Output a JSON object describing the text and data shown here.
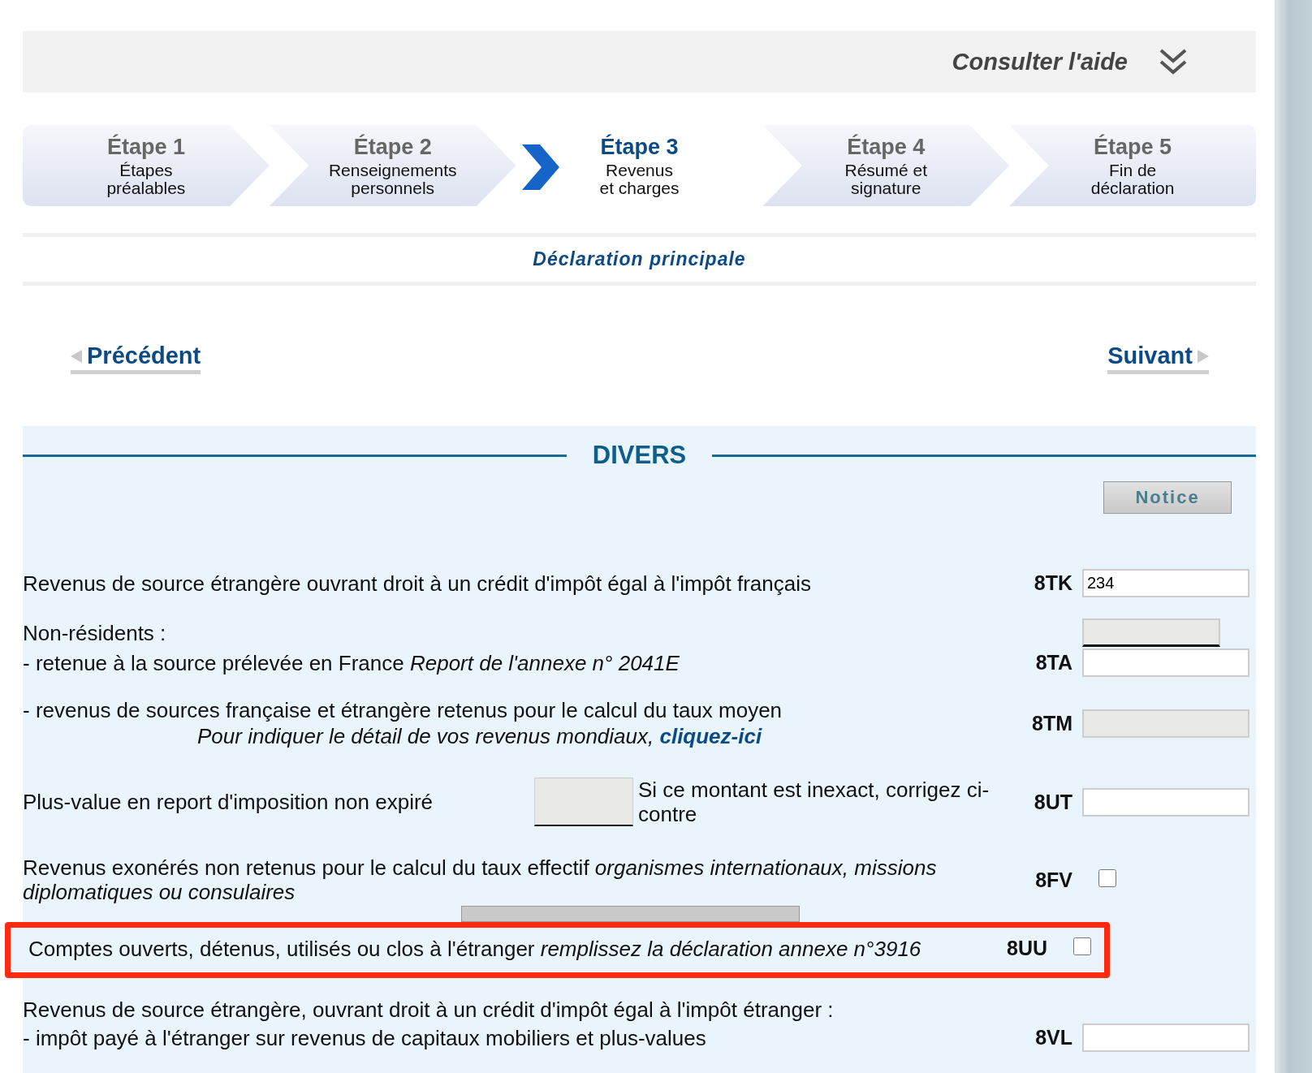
{
  "help": {
    "label": "Consulter l'aide"
  },
  "steps": [
    {
      "title": "Étape 1",
      "lines": [
        "Étapes",
        "préalables"
      ],
      "selected": false
    },
    {
      "title": "Étape 2",
      "lines": [
        "Renseignements",
        "personnels"
      ],
      "selected": false
    },
    {
      "title": "Étape 3",
      "lines": [
        "Revenus",
        "et charges"
      ],
      "selected": true
    },
    {
      "title": "Étape 4",
      "lines": [
        "Résumé et",
        "signature"
      ],
      "selected": false
    },
    {
      "title": "Étape 5",
      "lines": [
        "Fin de",
        "déclaration"
      ],
      "selected": false
    }
  ],
  "section_title": "Déclaration principale",
  "nav": {
    "previous": "Précédent",
    "next": "Suivant"
  },
  "divers": {
    "title": "DIVERS",
    "notice_button": "Notice",
    "rows": [
      {
        "kind": "input",
        "label": "Revenus de source étrangère ouvrant droit à un crédit d'impôt égal à l'impôt français",
        "code": "8TK",
        "value": "234",
        "disabled": false
      },
      {
        "kind": "heading-field",
        "label": "Non-résidents :"
      },
      {
        "kind": "input",
        "label": " - retenue à la source prélevée en France *Report de l'annexe n° 2041E*",
        "code": "8TA",
        "disabled": false
      },
      {
        "kind": "input",
        "label": " - revenus de sources française et étrangère retenus pour le calcul du taux moyen",
        "code": "8TM",
        "disabled": true,
        "sub": {
          "text": "Pour indiquer le détail de vos revenus mondiaux,",
          "link": "cliquez-ici"
        }
      },
      {
        "kind": "correction",
        "label": "Plus-value en report d'imposition non expiré",
        "side": "Si ce montant est inexact, corrigez ci-contre",
        "code": "8UT",
        "disabled": false
      },
      {
        "kind": "checkbox",
        "label": "Revenus exonérés non retenus pour le calcul du taux effectif *organismes internationaux, missions diplomatiques ou consulaires*",
        "code": "8FV",
        "checked": false,
        "highlighted": false
      },
      {
        "kind": "covered"
      },
      {
        "kind": "checkbox",
        "label": "Comptes ouverts, détenus, utilisés ou clos à l'étranger *remplissez la déclaration annexe n°3916*",
        "code": "8UU",
        "checked": false,
        "highlighted": true
      },
      {
        "kind": "heading",
        "label": "Revenus de source étrangère, ouvrant droit à un crédit d'impôt égal à l'impôt étranger :"
      },
      {
        "kind": "input",
        "label": " - impôt payé à l'étranger sur revenus de capitaux mobiliers et plus-values",
        "code": "8VL",
        "disabled": false
      }
    ]
  }
}
